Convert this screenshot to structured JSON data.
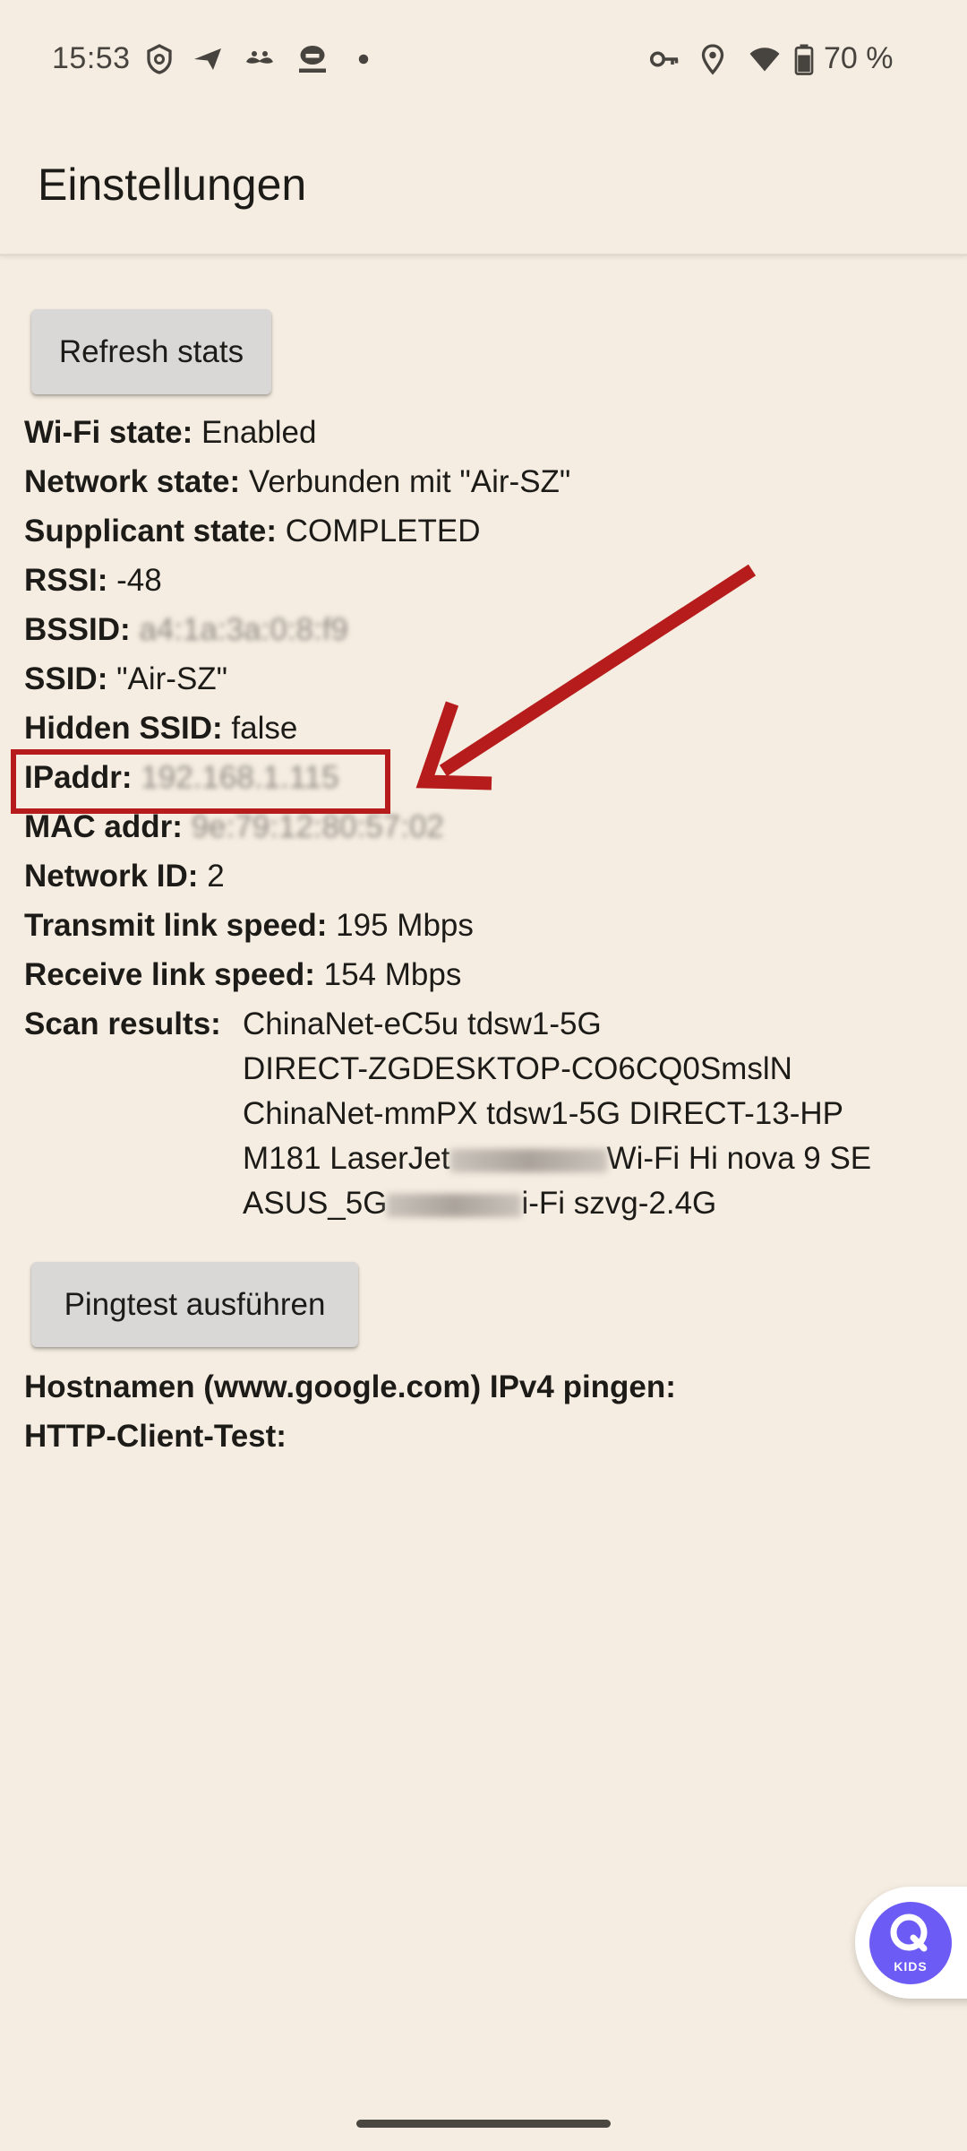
{
  "status_bar": {
    "time": "15:53",
    "battery_percent": "70 %",
    "left_icons": [
      "vpn-shield-icon",
      "send-icon",
      "mustache-icon",
      "tracker-icon",
      "dot-icon"
    ],
    "right_icons": [
      "key-icon",
      "location-icon",
      "wifi-icon",
      "battery-icon"
    ]
  },
  "app_bar": {
    "title": "Einstellungen"
  },
  "buttons": {
    "refresh": "Refresh stats",
    "ping": "Pingtest ausführen"
  },
  "stats": [
    {
      "label": "Wi-Fi state:",
      "value": "Enabled"
    },
    {
      "label": "Network state:",
      "value": "Verbunden mit \"Air-SZ\""
    },
    {
      "label": "Supplicant state:",
      "value": "COMPLETED"
    },
    {
      "label": "RSSI:",
      "value": "-48"
    },
    {
      "label": "BSSID:",
      "value": "a4:1a:3a:0:8:f9"
    },
    {
      "label": "SSID:",
      "value": "\"Air-SZ\""
    },
    {
      "label": "Hidden SSID:",
      "value": "false"
    },
    {
      "label": "IPaddr:",
      "value": "192.168.1.115"
    },
    {
      "label": "MAC addr:",
      "value": "9e:79:12:80:57:02"
    },
    {
      "label": "Network ID:",
      "value": "2"
    },
    {
      "label": "Transmit link speed:",
      "value": "195 Mbps"
    },
    {
      "label": "Receive link speed:",
      "value": "154 Mbps"
    }
  ],
  "scan": {
    "label": "Scan results:",
    "lines": [
      "ChinaNet-eC5u tdsw1-5G",
      "DIRECT-ZGDESKTOP-CO6CQ0SmslN",
      "ChinaNet-mmPX tdsw1-5G DIRECT-13-HP",
      "M181 LaserJet",
      "Wi-Fi Hi nova 9 SE",
      "ASUS_5G",
      "i-Fi szvg-2.4G"
    ]
  },
  "ping": {
    "hostname_label": "Hostnamen (www.google.com) IPv4 pingen:",
    "http_label": "HTTP-Client-Test:"
  },
  "kids_widget": {
    "label": "KIDS",
    "color": "#6d5bf5"
  },
  "annotation": {
    "color": "#b71c1c"
  }
}
